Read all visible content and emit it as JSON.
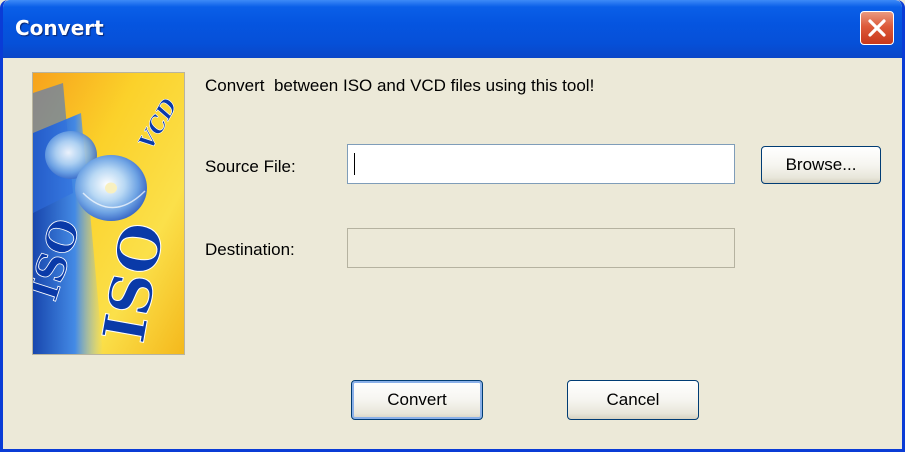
{
  "window": {
    "title": "Convert"
  },
  "logo": {
    "text_iso_large": "ISO",
    "text_iso_small": "ISO",
    "text_vcd": "VCD"
  },
  "main": {
    "description": "Convert  between ISO and VCD files using this tool!",
    "source_label": "Source File:",
    "source_value": "",
    "destination_label": "Destination:",
    "destination_value": ""
  },
  "buttons": {
    "browse": "Browse...",
    "convert": "Convert",
    "cancel": "Cancel"
  },
  "colors": {
    "titlebar": "#0555e0",
    "dialog_bg": "#ece9d8",
    "close_button": "#dd5a3a",
    "logo_yellow": "#f8cc20",
    "logo_blue": "#1a5fd0"
  }
}
